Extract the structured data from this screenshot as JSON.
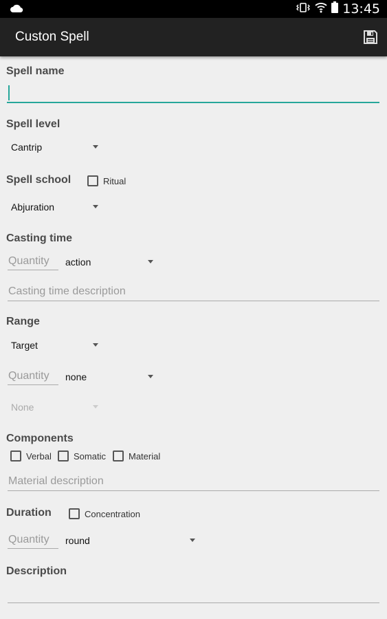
{
  "status_bar": {
    "time": "13:45",
    "icons": [
      "cloud-icon",
      "vibrate-icon",
      "wifi-icon",
      "battery-icon"
    ]
  },
  "app_bar": {
    "title": "Custon Spell",
    "save_icon": "floppy-disk-icon"
  },
  "form": {
    "spell_name": {
      "label": "Spell name",
      "value": ""
    },
    "spell_level": {
      "label": "Spell level",
      "selected": "Cantrip"
    },
    "spell_school": {
      "label": "Spell school",
      "selected": "Abjuration",
      "ritual_label": "Ritual",
      "ritual_checked": false
    },
    "casting_time": {
      "label": "Casting time",
      "quantity_placeholder": "Quantity",
      "unit_selected": "action",
      "description_placeholder": "Casting time description"
    },
    "range": {
      "label": "Range",
      "type_selected": "Target",
      "quantity_placeholder": "Quantity",
      "unit_selected": "none",
      "area_selected": "None"
    },
    "components": {
      "label": "Components",
      "verbal_label": "Verbal",
      "somatic_label": "Somatic",
      "material_label": "Material",
      "material_placeholder": "Material description"
    },
    "duration": {
      "label": "Duration",
      "concentration_label": "Concentration",
      "quantity_placeholder": "Quantity",
      "unit_selected": "round"
    },
    "description": {
      "label": "Description",
      "value": ""
    }
  },
  "colors": {
    "accent": "#26a69a",
    "app_bar": "#222222",
    "background": "#efefef"
  }
}
